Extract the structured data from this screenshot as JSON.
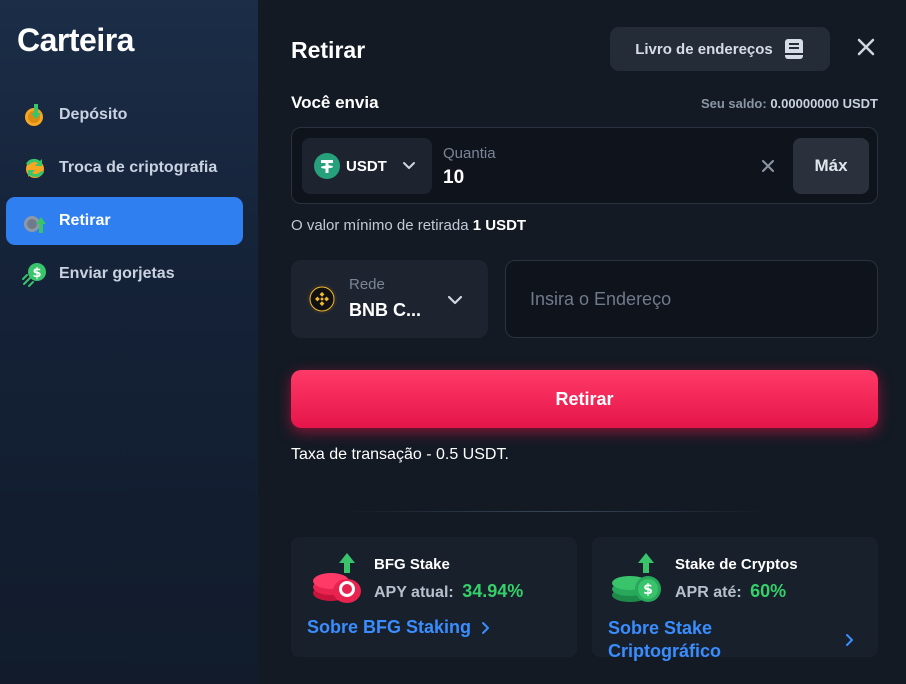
{
  "sidebar": {
    "title": "Carteira",
    "items": [
      {
        "label": "Depósito",
        "icon": "deposit-icon",
        "active": false
      },
      {
        "label": "Troca de criptografia",
        "icon": "swap-icon",
        "active": false
      },
      {
        "label": "Retirar",
        "icon": "withdraw-icon",
        "active": true
      },
      {
        "label": "Enviar gorjetas",
        "icon": "tip-icon",
        "active": false
      }
    ]
  },
  "main": {
    "title": "Retirar",
    "address_book_label": "Livro de endereços",
    "send_label": "Você envia",
    "balance_label": "Seu saldo:",
    "balance_value": "0.00000000 USDT",
    "currency": "USDT",
    "quantity_label": "Quantia",
    "quantity_value": "10",
    "max_label": "Máx",
    "min_text": "O valor mínimo de retirada",
    "min_value": "1 USDT",
    "network_label": "Rede",
    "network_value": "BNB C...",
    "address_placeholder": "Insira o Endereço",
    "withdraw_button": "Retirar",
    "fee_text": "Taxa de transação - 0.5 USDT."
  },
  "stakes": [
    {
      "title": "BFG Stake",
      "rate_label": "APY atual:",
      "rate_value": "34.94%",
      "link": "Sobre BFG Staking"
    },
    {
      "title": "Stake de Cryptos",
      "rate_label": "APR até:",
      "rate_value": "60%",
      "link": "Sobre Stake Criptográfico"
    }
  ],
  "colors": {
    "accent_blue": "#2f7ff0",
    "withdraw_red": "#ff2f5f",
    "positive_green": "#35d06a",
    "link_blue": "#3a8dff"
  }
}
